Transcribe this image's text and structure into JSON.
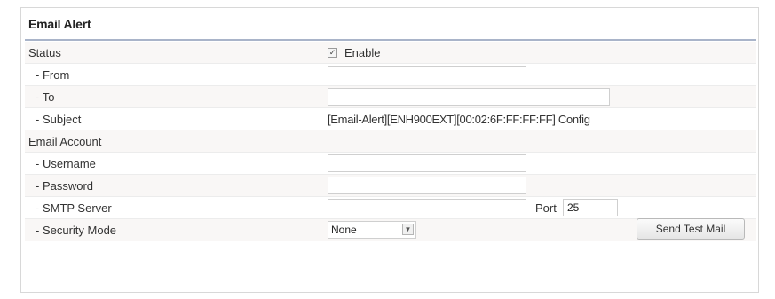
{
  "panel": {
    "title": "Email Alert"
  },
  "status": {
    "label": "Status",
    "enable_label": "Enable",
    "enabled": true
  },
  "from": {
    "label": "- From",
    "value": ""
  },
  "to": {
    "label": "- To",
    "value": ""
  },
  "subject": {
    "label": "- Subject",
    "value": "[Email-Alert][ENH900EXT][00:02:6F:FF:FF:FF] Config"
  },
  "email_account": {
    "label": "Email Account"
  },
  "username": {
    "label": "- Username",
    "value": ""
  },
  "password": {
    "label": "- Password",
    "value": ""
  },
  "smtp_server": {
    "label": "- SMTP Server",
    "value": "",
    "port_label": "Port",
    "port_value": "25"
  },
  "security_mode": {
    "label": "- Security Mode",
    "selected": "None"
  },
  "send_test_mail": {
    "label": "Send Test Mail"
  },
  "icons": {
    "checkbox": "checkbox-checked-icon",
    "dropdown": "dropdown-arrow-icon"
  }
}
